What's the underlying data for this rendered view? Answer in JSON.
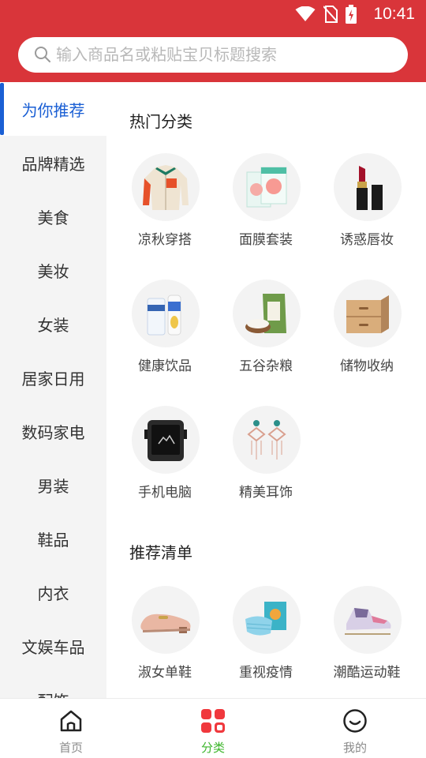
{
  "status": {
    "time": "10:41"
  },
  "search": {
    "placeholder": "输入商品名或粘贴宝贝标题搜索"
  },
  "sidebar": {
    "items": [
      {
        "label": "为你推荐",
        "active": true
      },
      {
        "label": "品牌精选"
      },
      {
        "label": "美食"
      },
      {
        "label": "美妆"
      },
      {
        "label": "女装"
      },
      {
        "label": "居家日用"
      },
      {
        "label": "数码家电"
      },
      {
        "label": "男装"
      },
      {
        "label": "鞋品"
      },
      {
        "label": "内衣"
      },
      {
        "label": "文娱车品"
      },
      {
        "label": "配饰"
      }
    ]
  },
  "hot": {
    "title": "热门分类",
    "items": [
      {
        "label": "凉秋穿搭",
        "icon": "jacket-icon"
      },
      {
        "label": "面膜套装",
        "icon": "face-mask-box-icon"
      },
      {
        "label": "诱惑唇妆",
        "icon": "lipstick-icon"
      },
      {
        "label": "健康饮品",
        "icon": "drink-bottles-icon"
      },
      {
        "label": "五谷杂粮",
        "icon": "grain-bag-icon"
      },
      {
        "label": "储物收纳",
        "icon": "drawer-box-icon"
      },
      {
        "label": "手机电脑",
        "icon": "rugged-phone-icon"
      },
      {
        "label": "精美耳饰",
        "icon": "earrings-icon"
      }
    ]
  },
  "recommend": {
    "title": "推荐清单",
    "items": [
      {
        "label": "淑女单鞋",
        "icon": "loafer-shoe-icon"
      },
      {
        "label": "重视疫情",
        "icon": "medical-mask-icon"
      },
      {
        "label": "潮酷运动鞋",
        "icon": "sneaker-icon"
      }
    ]
  },
  "bottomnav": {
    "items": [
      {
        "label": "首页",
        "icon": "home-icon"
      },
      {
        "label": "分类",
        "icon": "category-grid-icon",
        "active": true
      },
      {
        "label": "我的",
        "icon": "profile-face-icon"
      }
    ]
  },
  "colors": {
    "header": "#d9353a",
    "active_sidebar": "#1a5fd4",
    "active_nav": "#3cb52b",
    "category_icon": "#f0383d"
  }
}
